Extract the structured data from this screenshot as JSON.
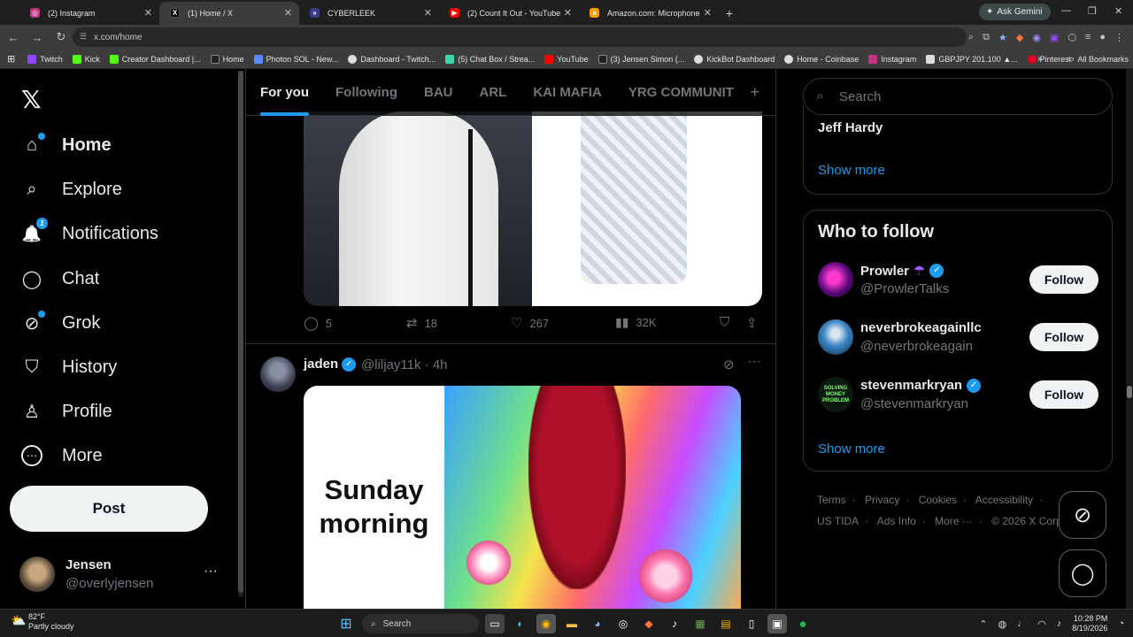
{
  "browser": {
    "tabs": [
      {
        "title": "(2) Instagram",
        "fav_color": "#c13584",
        "fav": "◎",
        "active": false
      },
      {
        "title": "(1) Home / X",
        "fav_color": "#000000",
        "fav": "X",
        "active": true
      },
      {
        "title": "CYBERLEEK",
        "fav_color": "#3a3a8a",
        "fav": "»",
        "active": false
      },
      {
        "title": "(2) Count It Out - YouTube",
        "fav_color": "#ff0000",
        "fav": "▶",
        "active": false
      },
      {
        "title": "Amazon.com: Microphone",
        "fav_color": "#ff9900",
        "fav": "a",
        "active": false
      }
    ],
    "ask_gemini": "Ask Gemini",
    "url": "x.com/home",
    "bookmarks": [
      {
        "label": "Twitch",
        "color": "#9146ff"
      },
      {
        "label": "Kick",
        "color": "#53fc18"
      },
      {
        "label": "Creator Dashboard |...",
        "color": "#53fc18"
      },
      {
        "label": "Home",
        "color": "#ffffff"
      },
      {
        "label": "Photon SOL - New...",
        "color": "#5b8cff"
      },
      {
        "label": "Dashboard - Twitch...",
        "color": "#ffffff"
      },
      {
        "label": "(5) Chat Box / Strea...",
        "color": "#38d9a9"
      },
      {
        "label": "YouTube",
        "color": "#ff0000"
      },
      {
        "label": "(3) Jensen Simon (...",
        "color": "#ffffff"
      },
      {
        "label": "KickBot Dashboard",
        "color": "#ffffff"
      },
      {
        "label": "Home - Coinbase",
        "color": "#ffffff"
      },
      {
        "label": "Instagram",
        "color": "#c13584"
      },
      {
        "label": "GBPJPY 201.100 ▲...",
        "color": "#ffffff"
      },
      {
        "label": "Pinterest",
        "color": "#e60023"
      }
    ],
    "all_bookmarks": "All Bookmarks"
  },
  "sidebar": {
    "logo": "𝕏",
    "items": [
      {
        "label": "Home",
        "icon": "⌂",
        "bold": true
      },
      {
        "label": "Explore",
        "icon": "⌕"
      },
      {
        "label": "Notifications",
        "icon": "🔔",
        "badge": "1"
      },
      {
        "label": "Chat",
        "icon": "◯"
      },
      {
        "label": "Grok",
        "icon": "⊘"
      },
      {
        "label": "History",
        "icon": "⛉"
      },
      {
        "label": "Profile",
        "icon": "♙"
      },
      {
        "label": "More",
        "icon": "⋯"
      }
    ],
    "post_label": "Post",
    "user": {
      "name": "Jensen",
      "handle": "@overlyjensen"
    }
  },
  "feed": {
    "tabs": [
      "For you",
      "Following",
      "BAU",
      "ARL",
      "KAI MAFIA",
      "YRG COMMUNIT"
    ],
    "tweet1_actions": {
      "replies": "5",
      "reposts": "18",
      "likes": "267",
      "views": "32K"
    },
    "tweet2": {
      "name": "jaden",
      "handle": "@liljay11k",
      "time": "· 4h",
      "image_text": "Sunday morning"
    }
  },
  "right": {
    "search_placeholder": "Search",
    "trend_name": "Jeff Hardy",
    "show_more": "Show more",
    "who_to_follow": "Who to follow",
    "follows": [
      {
        "name": "Prowler",
        "emoji": "☂",
        "handle": "@ProwlerTalks",
        "verified": true,
        "color": "#2a0a3a"
      },
      {
        "name": "neverbrokeagainllc",
        "emoji": "",
        "handle": "@neverbrokeagain",
        "verified": false,
        "color": "#1e4f7a"
      },
      {
        "name": "stevenmarkryan",
        "emoji": "",
        "handle": "@stevenmarkryan",
        "verified": true,
        "color": "#0b2a12"
      }
    ],
    "follow_label": "Follow",
    "footer": [
      "Terms",
      "Privacy",
      "Cookies",
      "Accessibility",
      "US TIDA",
      "Ads Info",
      "More ···",
      "© 2026 X Corp."
    ]
  },
  "taskbar": {
    "temp": "82°F",
    "weather": "Partly cloudy",
    "search": "Search",
    "time": "10:28 PM",
    "date": "8/19/2026"
  }
}
